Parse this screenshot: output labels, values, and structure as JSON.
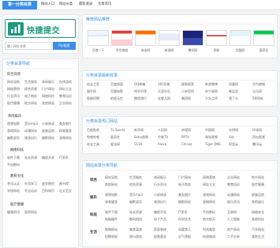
{
  "topbar": {
    "logo": "第一分类目录",
    "nav": [
      "网站入口",
      "网站分类",
      "最新收录",
      "文章资讯"
    ]
  },
  "left": {
    "submit_title": "快捷提交",
    "search_placeholder": "输入网址名称",
    "search_button": "Rip搜索",
    "section_title": "分类目录导航",
    "groups": [
      {
        "title": "综合其他",
        "links": [
          "网站导航",
          "生活服务",
          "休闲娱乐",
          "在线游戏",
          "网络营销",
          "综合资源",
          "门户网站",
          "网址大全",
          "行业资讯",
          "电子商务",
          "网络科技",
          "教育培训",
          "医疗健康",
          "地方网站",
          "其他网站",
          "企业网站"
        ]
      },
      {
        "title": "休闲娱乐",
        "links": [
          "视频电影",
          "音乐mp3",
          "小说阅读",
          "美女图片",
          "游戏网站",
          "动漫网站",
          "星座运势",
          "体育健身",
          "幽默笑话",
          "旅游出行",
          "摄影网站",
          "宠物网站"
        ]
      },
      {
        "title": "网络科技",
        "links": [
          "软件下载",
          "站长资源",
          "编程开发",
          "IT资讯",
          "手机数码"
        ]
      },
      {
        "title": "教育文化",
        "links": [
          "考试认证",
          "外语学习",
          "留学移民",
          "图书馆",
          "学校网站",
          "专业培训",
          "百科知识",
          "论文范文"
        ]
      },
      {
        "title": "医疗健康",
        "links": [
          "健康资讯",
          "医院网站"
        ]
      }
    ]
  },
  "recommend": {
    "title": "推荐网站推荐",
    "sites": [
      "百度一下",
      "京东商城",
      "淘宝网",
      "新浪网",
      "腾讯网",
      "网易",
      "优酷网",
      "爱奇艺"
    ]
  },
  "latest": {
    "title": "分类目录最新收录",
    "rows": [
      [
        "站长之家",
        "百度网盘",
        "QQ邮箱",
        "360导航",
        "搜狗搜索",
        "新浪微博",
        "凤凰网",
        "华为商城"
      ],
      [
        "猫扑网",
        "豆瓣电影",
        "知乎问答",
        "天涯社区",
        "小米官网",
        "苏宁易购",
        "唯品会",
        "当当网"
      ],
      [
        "智联招聘",
        "前程无忧",
        "携程旅行",
        "去哪儿网",
        "美团网",
        "大众点评",
        "饿了么",
        "58同城"
      ]
    ]
  },
  "hot": {
    "title": "分类目录热门网站",
    "rows": [
      [
        "百度贴吧",
        "TL Sports",
        "新华网",
        "人民网",
        "央视网",
        "中国网",
        "光明网",
        "环球网"
      ],
      [
        "哔哩哔哩",
        "爱奇艺",
        "Sohu视频",
        "芒果TV",
        "PPTV",
        "咪咕视频",
        "A站",
        "西瓜视频"
      ],
      [
        "站长工具",
        "爱站网",
        "5118",
        "Alexa",
        "Chinaz",
        "Tiger DNS",
        "阿里云",
        "腾讯云"
      ]
    ]
  },
  "categories": {
    "title": "网站目录分类导航",
    "rows": [
      {
        "head": "综合",
        "cells": [
          "网站导航",
          "生活服务",
          "休闲娱乐",
          "门户网站",
          "网络营销",
          "企业网站",
          "地方网站",
          "其他网站",
          "综合资源",
          "行业资讯",
          "电子商务",
          "网址大全",
          "教育培训",
          "医疗健康"
        ]
      },
      {
        "head": "娱乐",
        "cells": [
          "视频电影",
          "音乐mp3",
          "小说阅读",
          "美女图片",
          "游戏网站",
          "动漫网站",
          "星座运势",
          "体育健身",
          "幽默笑话",
          "旅游出行",
          "摄影网站",
          "宠物网站",
          "娱乐资讯",
          "其他娱乐"
        ]
      },
      {
        "head": "科技",
        "cells": [
          "软件下载",
          "站长资源",
          "编程开发",
          "IT资讯",
          "手机数码",
          "互联网",
          "网络安全",
          "电脑硬件",
          "数码相机",
          "电子产品",
          "科学技术",
          "航空航天",
          "人工智能",
          "其他科技"
        ]
      },
      {
        "head": "生活",
        "cells": [
          "购物网站",
          "美食菜谱",
          "家居装修",
          "母婴育儿",
          "时尚美容",
          "房产网站",
          "汽车网站",
          "招聘求职",
          "银行保险",
          "股票基金",
          "天气预报",
          "快递物流",
          "二手交易",
          "其他生活"
        ]
      }
    ]
  },
  "colors": {
    "accent": "#3a8ee6",
    "submit_green": "#1f9a7c"
  }
}
